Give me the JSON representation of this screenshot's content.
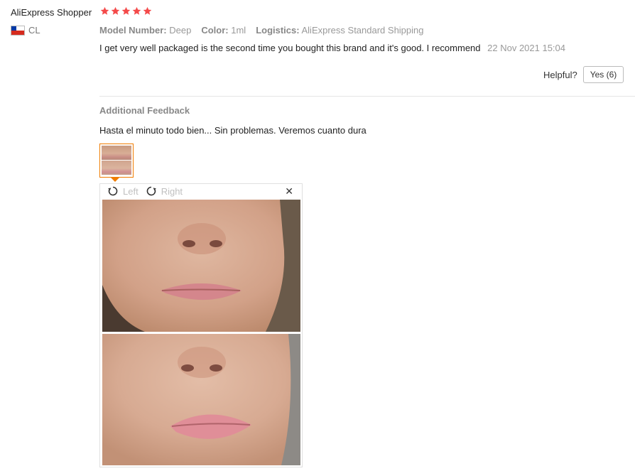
{
  "review": {
    "user_name": "AliExpress Shopper",
    "rating": 5,
    "country_code": "CL",
    "model_label": "Model Number:",
    "model_value": "Deep",
    "color_label": "Color:",
    "color_value": "1ml",
    "logistics_label": "Logistics:",
    "logistics_value": "AliExpress Standard Shipping",
    "text": "I get very well packaged is the second time you bought this brand and it's good. I recommend",
    "date": "22 Nov 2021 15:04"
  },
  "helpful": {
    "label": "Helpful?",
    "yes_label": "Yes (6)"
  },
  "additional": {
    "title": "Additional Feedback",
    "text": "Hasta el minuto todo bien... Sin problemas. Veremos cuanto dura"
  },
  "viewer": {
    "left_label": "Left",
    "right_label": "Right",
    "close_glyph": "✕"
  },
  "colors": {
    "star": "#f44a4a",
    "accent": "#f07c00",
    "muted": "#999999"
  }
}
